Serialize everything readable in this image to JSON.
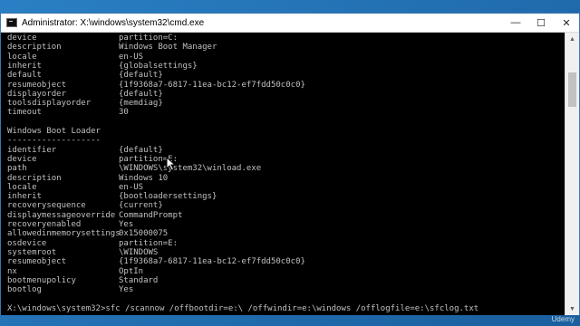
{
  "window": {
    "title": "Administrator: X:\\windows\\system32\\cmd.exe",
    "minimize": "—",
    "maximize": "☐",
    "close": "✕"
  },
  "console": {
    "lines": [
      {
        "key": "device",
        "val": "partition=C:"
      },
      {
        "key": "description",
        "val": "Windows Boot Manager"
      },
      {
        "key": "locale",
        "val": "en-US"
      },
      {
        "key": "inherit",
        "val": "{globalsettings}"
      },
      {
        "key": "default",
        "val": "{default}"
      },
      {
        "key": "resumeobject",
        "val": "{1f9368a7-6817-11ea-bc12-ef7fdd50c0c0}"
      },
      {
        "key": "displayorder",
        "val": "{default}"
      },
      {
        "key": "toolsdisplayorder",
        "val": "{memdiag}"
      },
      {
        "key": "timeout",
        "val": "30"
      },
      {
        "key": "",
        "val": ""
      },
      {
        "key": "Windows Boot Loader",
        "val": ""
      },
      {
        "key": "-------------------",
        "val": ""
      },
      {
        "key": "identifier",
        "val": "{default}"
      },
      {
        "key": "device",
        "val": "partition=E:"
      },
      {
        "key": "path",
        "val": "\\WINDOWS\\system32\\winload.exe"
      },
      {
        "key": "description",
        "val": "Windows 10"
      },
      {
        "key": "locale",
        "val": "en-US"
      },
      {
        "key": "inherit",
        "val": "{bootloadersettings}"
      },
      {
        "key": "recoverysequence",
        "val": "{current}"
      },
      {
        "key": "displaymessageoverride",
        "val": "CommandPrompt"
      },
      {
        "key": "recoveryenabled",
        "val": "Yes"
      },
      {
        "key": "allowedinmemorysettings",
        "val": "0x15000075"
      },
      {
        "key": "osdevice",
        "val": "partition=E:"
      },
      {
        "key": "systemroot",
        "val": "\\WINDOWS"
      },
      {
        "key": "resumeobject",
        "val": "{1f9368a7-6817-11ea-bc12-ef7fdd50c0c0}"
      },
      {
        "key": "nx",
        "val": "OptIn"
      },
      {
        "key": "bootmenupolicy",
        "val": "Standard"
      },
      {
        "key": "bootlog",
        "val": "Yes"
      },
      {
        "key": "",
        "val": ""
      },
      {
        "key": "X:\\windows\\system32>sfc /scannow /offbootdir=e:\\ /offwindir=e:\\windows /offlogfile=e:\\sfclog.txt",
        "val": ""
      }
    ]
  },
  "scrollbar": {
    "up": "▲",
    "down": "▼"
  },
  "watermark": "Udemy",
  "icons": {
    "app": "cmd-icon",
    "cursor": "mouse-pointer-icon"
  }
}
